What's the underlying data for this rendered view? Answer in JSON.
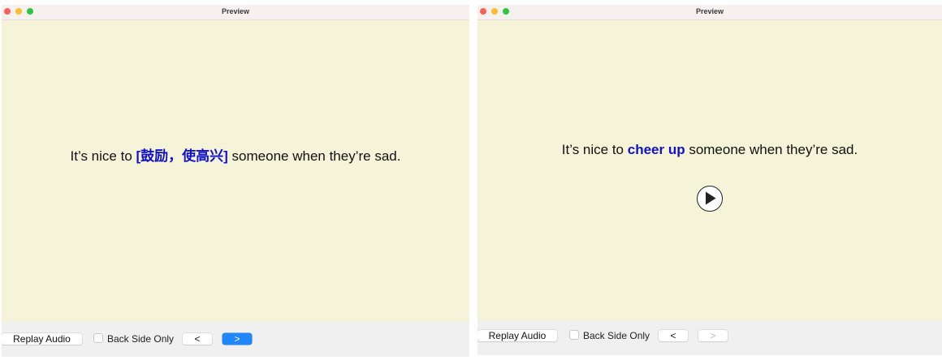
{
  "colors": {
    "close": "#fe5f57",
    "minimize": "#febc2e",
    "zoom": "#28c840",
    "card_background": "#f5f4d8",
    "highlight": "#1010cc",
    "primary_button": "#1f86fb"
  },
  "windows": [
    {
      "title": "Preview",
      "card": {
        "prefix": "It’s nice to ",
        "highlight": "[鼓励，使高兴]",
        "suffix": " someone when they’re sad."
      },
      "controls": {
        "replay_label": "Replay Audio",
        "back_side_label": "Back Side Only",
        "back_side_checked": false,
        "prev_label": "<",
        "next_label": ">"
      }
    },
    {
      "title": "Preview",
      "card": {
        "prefix": "It’s nice to ",
        "highlight": "cheer up",
        "suffix": " someone when they’re sad.",
        "play_icon": "play-icon"
      },
      "controls": {
        "replay_label": "Replay Audio",
        "back_side_label": "Back Side Only",
        "back_side_checked": false,
        "prev_label": "<",
        "next_label": ">",
        "next_enabled": false
      }
    }
  ]
}
